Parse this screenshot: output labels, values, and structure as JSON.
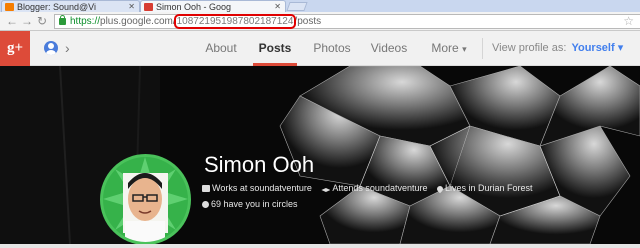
{
  "browser": {
    "tabs": [
      {
        "title": "Blogger: Sound@Vi"
      },
      {
        "title": "Simon Ooh - Goog"
      }
    ],
    "url_scheme": "https://",
    "url_host": "plus.google.com/",
    "url_id": "108721951987802187124",
    "url_path": "/posts"
  },
  "gplus": {
    "logo": "g+",
    "nav_tabs": [
      "About",
      "Posts",
      "Photos",
      "Videos",
      "More"
    ],
    "active_tab": "Posts",
    "view_profile_label": "View profile as:",
    "view_profile_value": "Yourself"
  },
  "profile": {
    "name": "Simon Ooh",
    "work": "Works at soundatventure",
    "education": "Attends soundatventure",
    "location": "Lives in Durian Forest",
    "circles": "69 have you in circles"
  },
  "colors": {
    "gplus_red": "#dd4b39",
    "link_blue": "#427fed",
    "url_highlight": "#e00000",
    "avatar_green": "#36b24a"
  }
}
